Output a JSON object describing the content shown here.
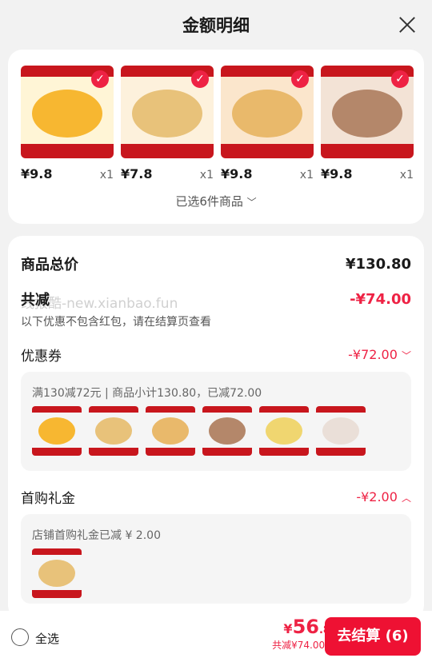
{
  "header": {
    "title": "金额明细"
  },
  "products": [
    {
      "price": "¥9.8",
      "qty": "x1",
      "color": "#f7b731"
    },
    {
      "price": "¥7.8",
      "qty": "x1",
      "color": "#e8c27a"
    },
    {
      "price": "¥9.8",
      "qty": "x1",
      "color": "#e9b96b"
    },
    {
      "price": "¥9.8",
      "qty": "x1",
      "color": "#b4876a"
    }
  ],
  "selected_text": "已选6件商品",
  "summary": {
    "total_label": "商品总价",
    "total_value": "¥130.80",
    "discount_label": "共减",
    "discount_value": "-¥74.00",
    "note": "以下优惠不包含红包，请在结算页查看",
    "watermark": "线报酷-new.xianbao.fun"
  },
  "coupon": {
    "label": "优惠券",
    "value": "-¥72.00",
    "detail": "满130减72元 | 商品小计130.80，已减72.00",
    "thumb_colors": [
      "#f7b731",
      "#e8c27a",
      "#e9b96b",
      "#b4876a",
      "#f0d670",
      "#eadfd8"
    ]
  },
  "gift": {
    "label": "首购礼金",
    "value": "-¥2.00",
    "detail": "店铺首购礼金已减 ¥ 2.00",
    "thumb_color": "#e8c27a"
  },
  "bottom": {
    "select_all": "全选",
    "currency": "¥",
    "amount_int": "56",
    "amount_dec": ".80",
    "discount_text": "共减¥74.00",
    "checkout": "去结算 (6)"
  },
  "colors": {
    "accent": "#ee2244",
    "brand_red": "#c8161d"
  }
}
